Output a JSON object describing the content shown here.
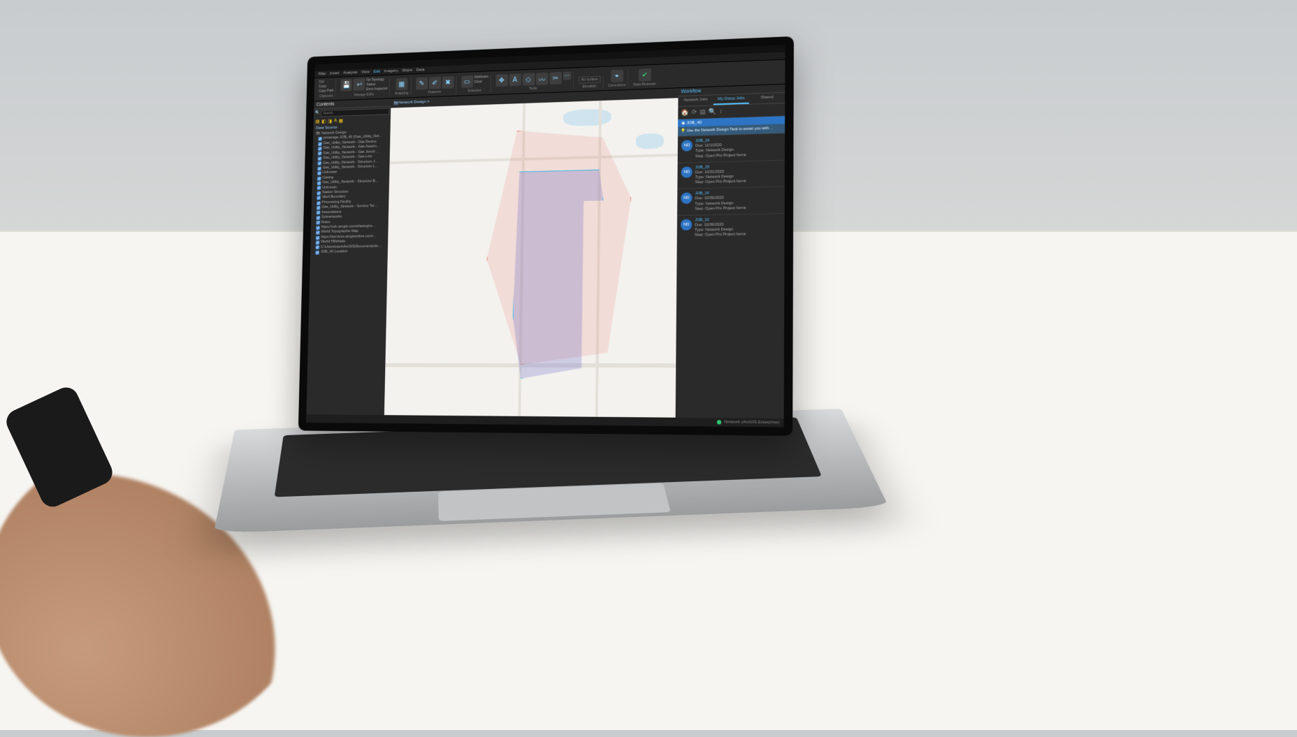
{
  "menu": [
    "Map",
    "Insert",
    "Analysis",
    "View",
    "Edit",
    "Imagery",
    "Share",
    "Data"
  ],
  "ribbon": {
    "clipboard": {
      "cut": "Cut",
      "copy": "Copy",
      "paste": "Copy Path",
      "group": "Clipboard"
    },
    "manage": {
      "save": "Save",
      "discard": "Discard",
      "no_topo": "No Topology",
      "status": "Status",
      "error_insp": "Error Inspector",
      "group": "Manage Edits"
    },
    "snapping": {
      "label": "Snapping",
      "group": "Snapping"
    },
    "features": {
      "create": "Create",
      "modify": "Modify",
      "delete": "Delete",
      "group": "Features"
    },
    "selection": {
      "select": "Select",
      "attrs": "Attributes",
      "clear": "Clear",
      "group": "Selection"
    },
    "tools": {
      "move": "Move",
      "annotation": "Annotation",
      "edit_vertices": "Edit Vertices",
      "reshape": "Reshape",
      "split": "Split",
      "more": "More",
      "group": "Tools"
    },
    "elevation": {
      "mode": "No surface",
      "group": "Elevation"
    },
    "construction": {
      "ground": "Ground To Grid",
      "group": "Corrections"
    },
    "data_reviewer": {
      "manage": "Manage Quality",
      "group": "Data Reviewer"
    }
  },
  "contents": {
    "title": "Contents",
    "search_ph": "Search",
    "section": "Data Source",
    "root": "Network Design",
    "layers": [
      "jsmanage.JOB_40 (Gas_Utility_Net…",
      "Gas_Utility_Network - Gas Device",
      "Gas_Utility_Network - Gas Assem…",
      "Gas_Utility_Network - Gas Juncti…",
      "Gas_Utility_Network - Gas Line",
      "Gas_Utility_Network - Structure J…",
      "Gas_Utility_Network - Structure L…",
      "Unknown",
      "Casing",
      "Gas_Utility_Network - Structure B…",
      "Unknown",
      "Station Structure",
      "Vault Boundary",
      "Processing Facility",
      "Gas_Utility_Network - Service Ter…",
      "Associations",
      "Subnetworks",
      "Rules",
      "https://cdn.arcgis.com/sharing/re…",
      "World Topographic Map",
      "https://services.arcgisonline.com/…",
      "World Hillshade",
      "C:\\Users\\user\\ArcGIS\\Documents\\Ar…",
      "JOB_40 Location"
    ]
  },
  "map_tab": "Network Design ×",
  "workflow": {
    "title": "Workflow",
    "tabs": [
      "Network Jobs",
      "My Group Jobs",
      "Shared"
    ],
    "active_tab": 1,
    "current": "JOB_40",
    "hint": "Use the Network Design Task to assist you with…",
    "due_lbl": "Due:",
    "type_lbl": "Type:",
    "step_lbl": "Step:",
    "jobs": [
      {
        "id": "JOB_24",
        "due": "11/1/2020",
        "type": "Network Design",
        "step": "Open Pro Project Items"
      },
      {
        "id": "JOB_25",
        "due": "10/31/2020",
        "type": "Network Design",
        "step": "Open Pro Project Items"
      },
      {
        "id": "JOB_14",
        "due": "10/30/2020",
        "type": "Network Design",
        "step": "Open Pro Project Items"
      },
      {
        "id": "JOB_10",
        "due": "10/30/2020",
        "type": "Network Design",
        "step": "Open Pro Project Items"
      }
    ]
  },
  "status": "Network (ArcGIS Enterprise)"
}
